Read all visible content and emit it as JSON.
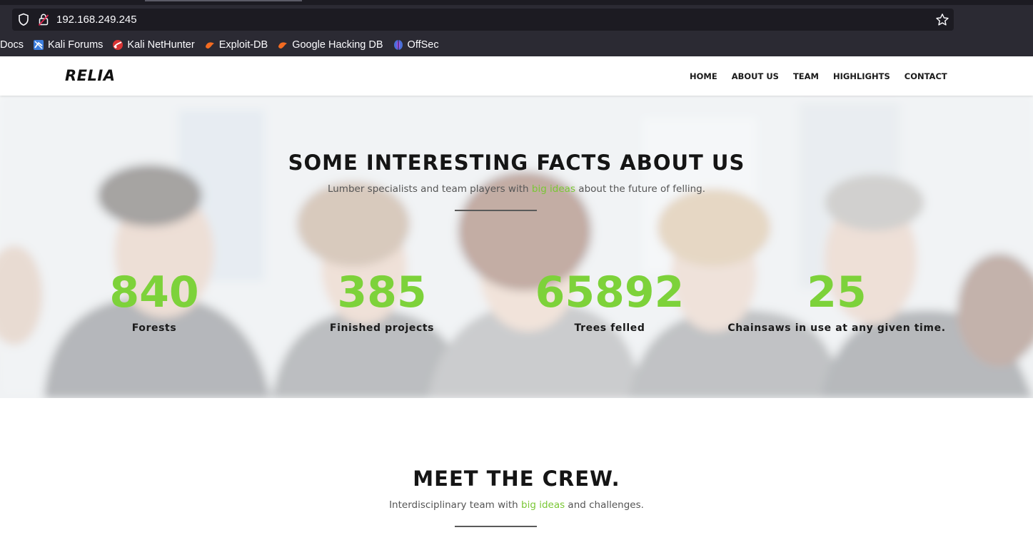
{
  "browser": {
    "url": "192.168.249.245",
    "bookmarks": [
      {
        "label": "Docs",
        "icon": "docs-icon"
      },
      {
        "label": "Kali Forums",
        "icon": "kali-forums-icon"
      },
      {
        "label": "Kali NetHunter",
        "icon": "kali-nethunter-icon"
      },
      {
        "label": "Exploit-DB",
        "icon": "exploit-db-icon"
      },
      {
        "label": "Google Hacking DB",
        "icon": "google-hacking-db-icon"
      },
      {
        "label": "OffSec",
        "icon": "offsec-icon"
      }
    ]
  },
  "site": {
    "logo": "RELIA",
    "nav": [
      "HOME",
      "ABOUT US",
      "TEAM",
      "HIGHLIGHTS",
      "CONTACT"
    ],
    "accent_color": "#7dd23a"
  },
  "facts": {
    "title": "SOME INTERESTING FACTS ABOUT US",
    "subtitle_before": "Lumber specialists and team players with ",
    "subtitle_accent": "big ideas",
    "subtitle_after": " about the future of felling.",
    "stats": [
      {
        "number": "840",
        "label": "Forests"
      },
      {
        "number": "385",
        "label": "Finished projects"
      },
      {
        "number": "65892",
        "label": "Trees felled"
      },
      {
        "number": "25",
        "label": "Chainsaws in use at any given time."
      }
    ]
  },
  "crew": {
    "title": "MEET THE CREW.",
    "subtitle_before": "Interdisciplinary team with ",
    "subtitle_accent": "big ideas",
    "subtitle_after": " and challenges."
  }
}
